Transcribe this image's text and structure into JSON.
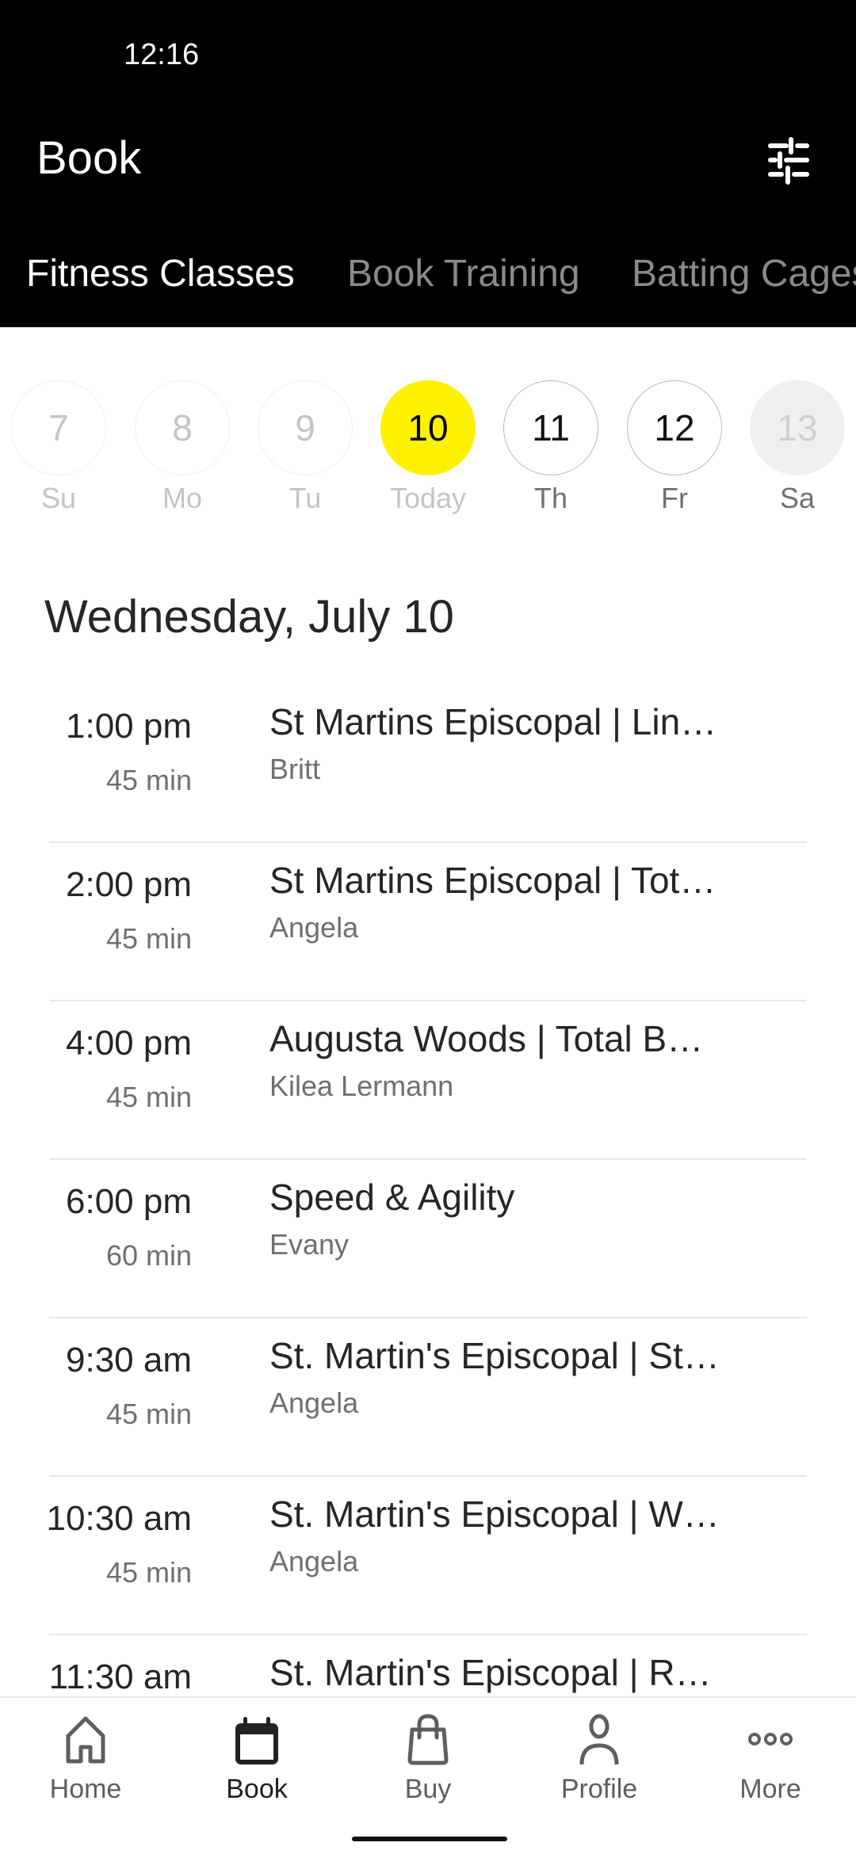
{
  "status_bar": {
    "time": "12:16"
  },
  "header": {
    "title": "Book",
    "filter_icon": "sliders-icon"
  },
  "tabs": [
    {
      "label": "Fitness Classes",
      "active": true
    },
    {
      "label": "Book Training",
      "active": false
    },
    {
      "label": "Batting Cages",
      "active": false
    }
  ],
  "date_strip": {
    "days": [
      {
        "number": "7",
        "label": "Su",
        "state": "past"
      },
      {
        "number": "8",
        "label": "Mo",
        "state": "past"
      },
      {
        "number": "9",
        "label": "Tu",
        "state": "past"
      },
      {
        "number": "10",
        "label": "Today",
        "state": "selected"
      },
      {
        "number": "11",
        "label": "Th",
        "state": "future"
      },
      {
        "number": "12",
        "label": "Fr",
        "state": "future"
      },
      {
        "number": "13",
        "label": "Sa",
        "state": "unavailable"
      }
    ],
    "selected_color": "#fff200"
  },
  "schedule": {
    "date_heading": "Wednesday, July 10",
    "classes": [
      {
        "time": "1:00 pm",
        "duration": "45 min",
        "title": "St Martins Episcopal | Lin…",
        "instructor": "Britt"
      },
      {
        "time": "2:00 pm",
        "duration": "45 min",
        "title": "St Martins Episcopal | Tot…",
        "instructor": "Angela"
      },
      {
        "time": "4:00 pm",
        "duration": "45 min",
        "title": "Augusta Woods | Total B…",
        "instructor": "Kilea Lermann"
      },
      {
        "time": "6:00 pm",
        "duration": "60 min",
        "title": "Speed & Agility",
        "instructor": "Evany"
      },
      {
        "time": "9:30 am",
        "duration": "45 min",
        "title": "St. Martin's Episcopal | St…",
        "instructor": "Angela"
      },
      {
        "time": "10:30 am",
        "duration": "45 min",
        "title": "St. Martin's Episcopal | W…",
        "instructor": "Angela"
      },
      {
        "time": "11:30 am",
        "duration": "",
        "title": "St. Martin's Episcopal | R…",
        "instructor": ""
      }
    ]
  },
  "bottom_nav": {
    "items": [
      {
        "label": "Home",
        "icon": "home-icon",
        "active": false
      },
      {
        "label": "Book",
        "icon": "calendar-icon",
        "active": true
      },
      {
        "label": "Buy",
        "icon": "shopping-bag-icon",
        "active": false
      },
      {
        "label": "Profile",
        "icon": "person-icon",
        "active": false
      },
      {
        "label": "More",
        "icon": "more-dots-icon",
        "active": false
      }
    ]
  }
}
